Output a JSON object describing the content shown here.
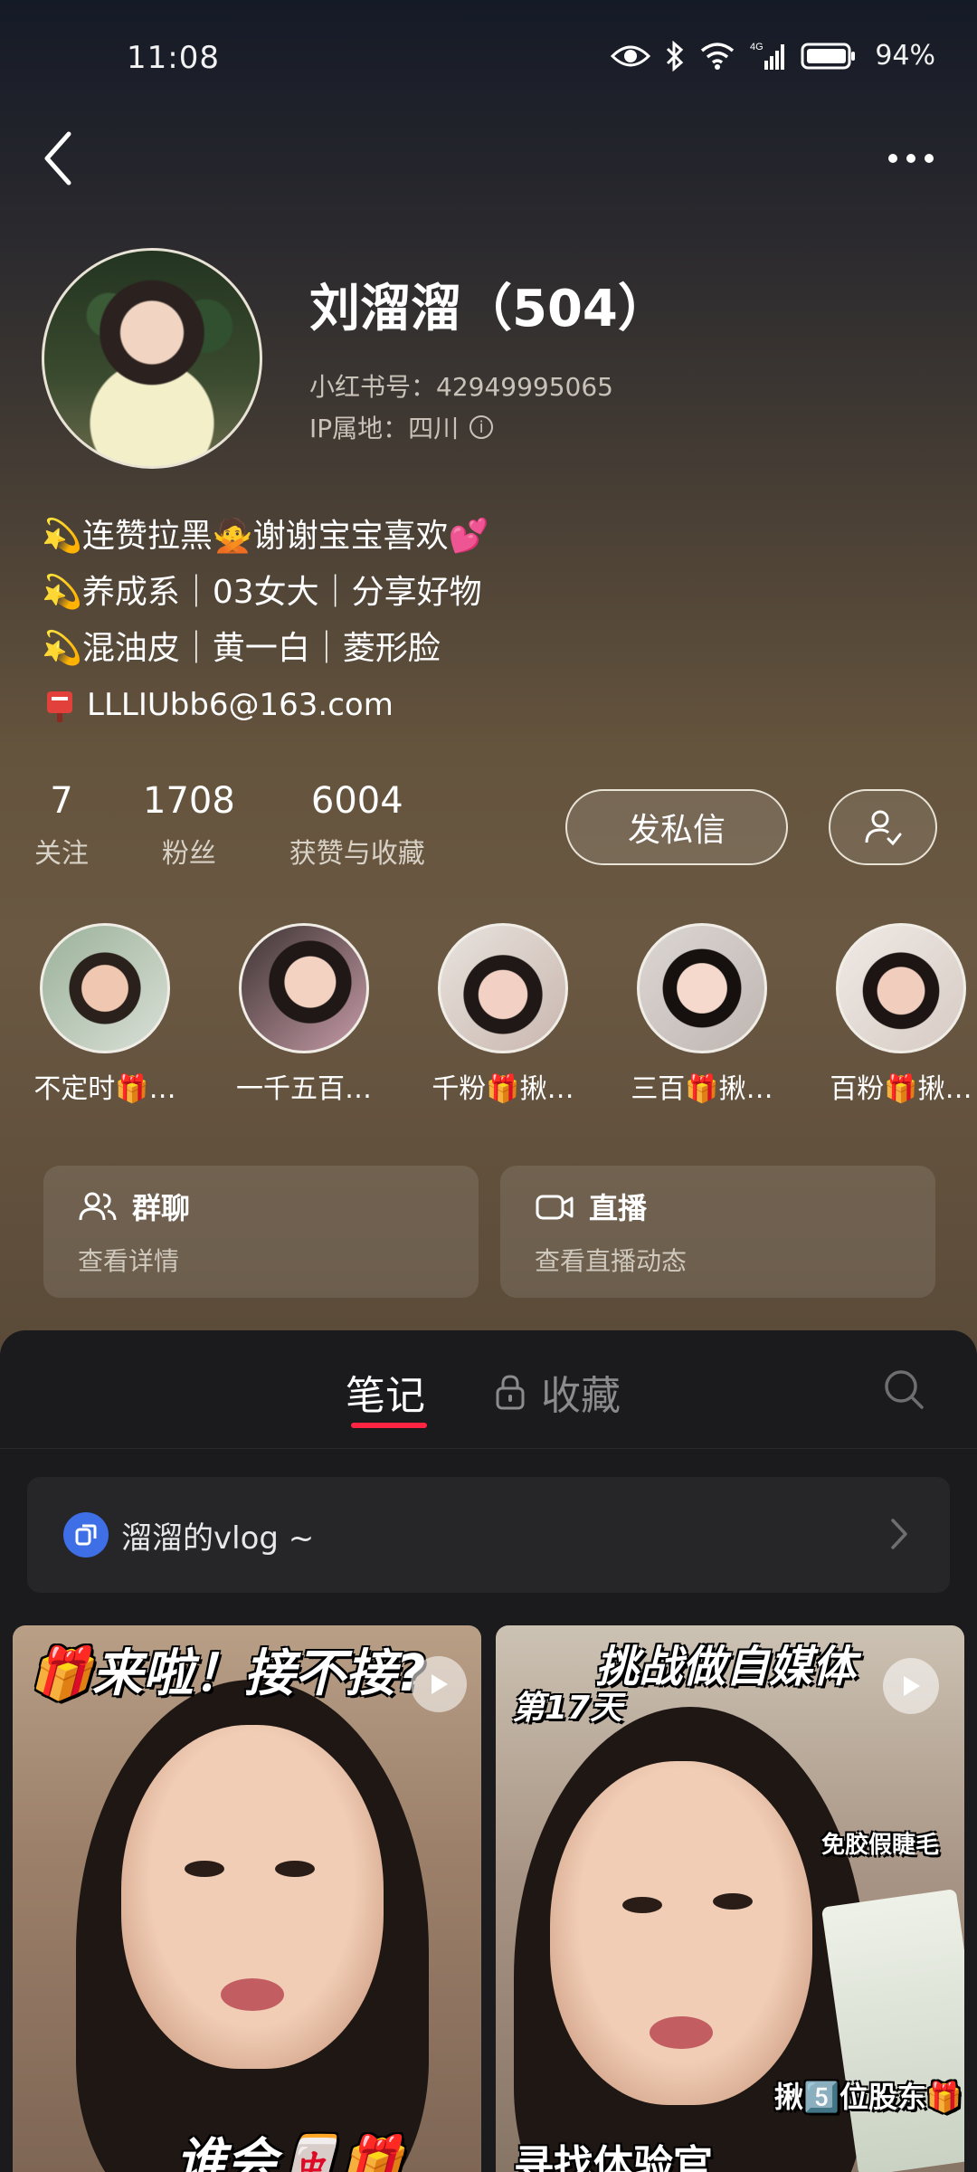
{
  "status_bar": {
    "time": "11:08",
    "battery": "94%",
    "network": "4G"
  },
  "profile": {
    "name": "刘溜溜（504）",
    "redid": "小红书号：42949995065",
    "ip": "IP属地：四川",
    "bio": [
      "💫连赞拉黑🙅谢谢宝宝喜欢💕",
      "💫养成系｜03女大｜分享好物",
      "💫混油皮｜黄一白｜菱形脸"
    ],
    "email": "LLLIUbb6@163.com"
  },
  "stats": [
    {
      "num": "7",
      "label": "关注"
    },
    {
      "num": "1708",
      "label": "粉丝"
    },
    {
      "num": "6004",
      "label": "获赞与收藏"
    }
  ],
  "buttons": {
    "message": "发私信"
  },
  "highlights": [
    {
      "label": "不定时🎁…"
    },
    {
      "label": "一千五百…"
    },
    {
      "label": "千粉🎁揪…"
    },
    {
      "label": "三百🎁揪…"
    },
    {
      "label": "百粉🎁揪…"
    }
  ],
  "cards": {
    "group": {
      "title": "群聊",
      "subtitle": "查看详情"
    },
    "live": {
      "title": "直播",
      "subtitle": "查看直播动态"
    }
  },
  "tabs": {
    "notes": "笔记",
    "favorites": "收藏"
  },
  "collection": {
    "title": "溜溜的vlog ~"
  },
  "notes": [
    {
      "title": "🎁来啦！接不接?",
      "bottom": "谁会🀄🎁呢?"
    },
    {
      "title": "挑战做自媒体",
      "subtitle": "第17天",
      "side": "免胶假睫毛",
      "bottom_right": "揪5️⃣位股东🎁",
      "bottom": "寻找体验官"
    }
  ],
  "colors": {
    "accent": "#ff2442",
    "collection_icon": "#3e6fe6"
  }
}
